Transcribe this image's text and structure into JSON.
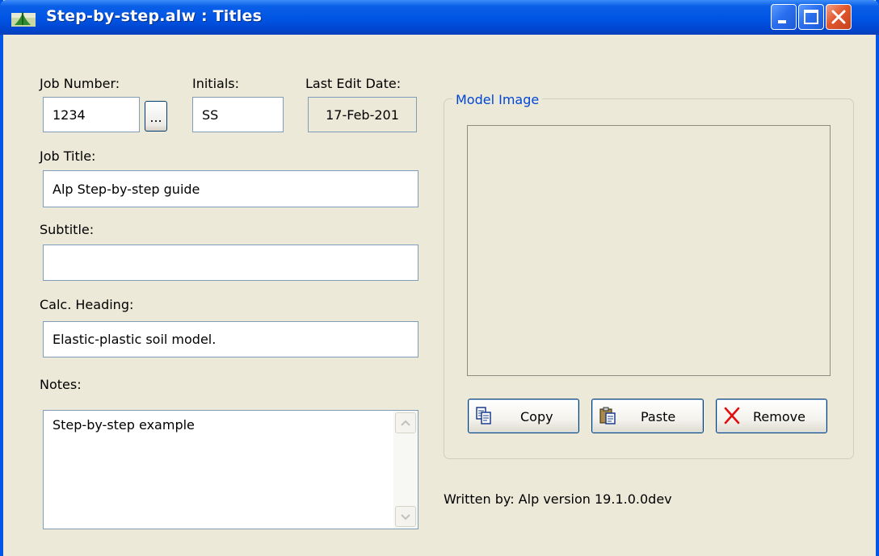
{
  "window": {
    "title": "Step-by-step.alw : Titles"
  },
  "fields": {
    "job_number": {
      "label": "Job Number:",
      "value": "1234"
    },
    "browse_label": "...",
    "initials": {
      "label": "Initials:",
      "value": "SS"
    },
    "last_edit_date": {
      "label": "Last Edit Date:",
      "value": "17-Feb-201"
    },
    "job_title": {
      "label": "Job Title:",
      "value": "Alp Step-by-step guide"
    },
    "subtitle": {
      "label": "Subtitle:",
      "value": ""
    },
    "calc_heading": {
      "label": "Calc. Heading:",
      "value": "Elastic-plastic soil model."
    },
    "notes": {
      "label": "Notes:",
      "value": "Step-by-step example"
    }
  },
  "model_image": {
    "group_title": "Model Image",
    "buttons": {
      "copy": "Copy",
      "paste": "Paste",
      "remove": "Remove"
    }
  },
  "footer": {
    "written_by": "Written by: Alp version 19.1.0.0dev"
  }
}
